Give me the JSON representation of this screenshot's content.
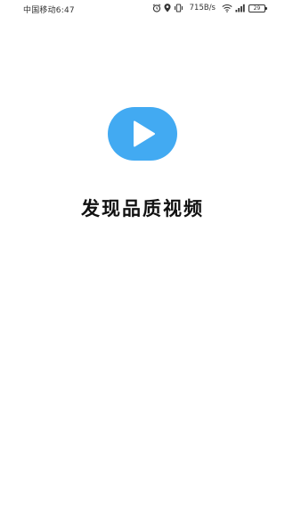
{
  "status_bar": {
    "carrier_time": "中国移动6:47",
    "net_speed": "715B/s",
    "battery_level": "29",
    "icons": [
      "alarm-icon",
      "location-icon",
      "vibrate-icon",
      "wifi-icon",
      "cellular-signal-icon",
      "battery-icon"
    ]
  },
  "splash": {
    "logo_icon": "play-icon",
    "logo_color": "#42aaf2",
    "title": "发现品质视频"
  }
}
